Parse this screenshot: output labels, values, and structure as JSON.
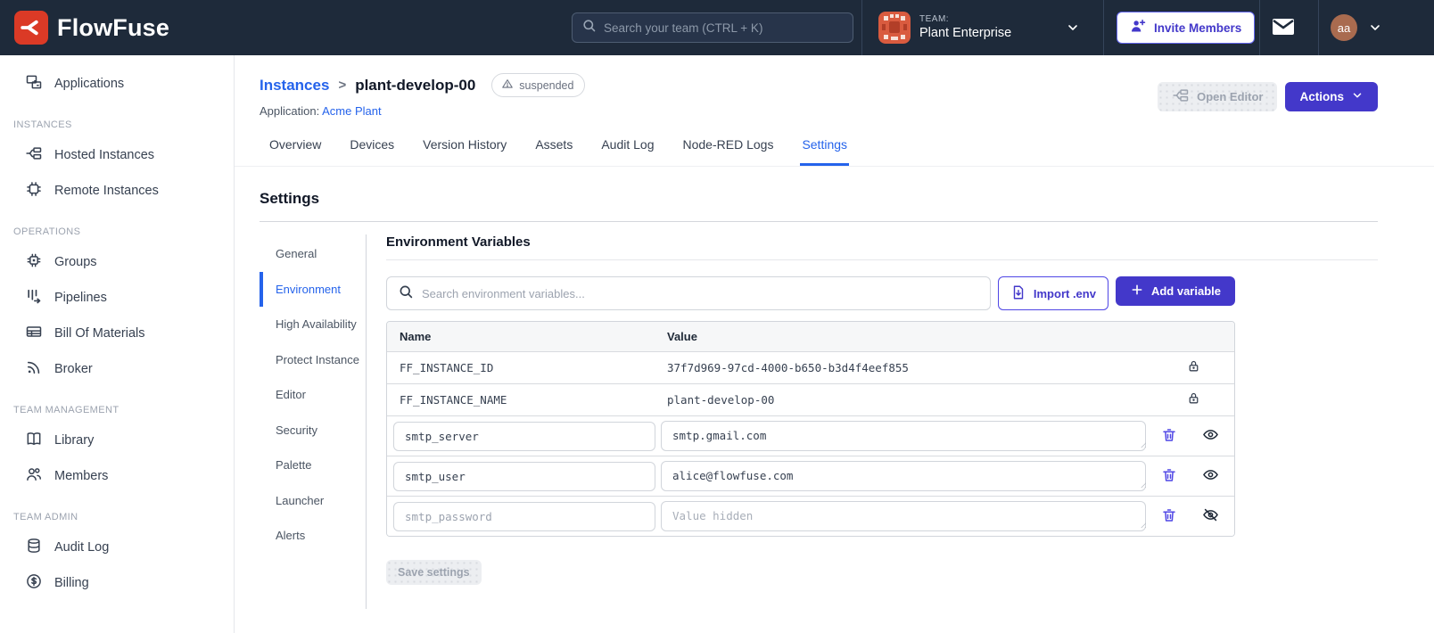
{
  "colors": {
    "header_bg": "#1E2A3A",
    "brand_red": "#DB3A26",
    "accent_indigo": "#4338CA",
    "link_blue": "#2563EB",
    "muted_gray": "#9CA3AF"
  },
  "header": {
    "brand": "FlowFuse",
    "search_placeholder": "Search your team (CTRL + K)",
    "team_label": "TEAM:",
    "team_name": "Plant Enterprise",
    "invite_button": "Invite Members",
    "avatar_initials": "aa",
    "icons": [
      "search-icon",
      "chevron-down-icon",
      "user-plus-icon",
      "mail-icon"
    ]
  },
  "sidebar": {
    "sections": [
      {
        "title": "",
        "items": [
          {
            "label": "Applications",
            "icon": "applications-icon"
          }
        ]
      },
      {
        "title": "INSTANCES",
        "items": [
          {
            "label": "Hosted Instances",
            "icon": "hosted-instances-icon"
          },
          {
            "label": "Remote Instances",
            "icon": "remote-instances-icon"
          }
        ]
      },
      {
        "title": "OPERATIONS",
        "items": [
          {
            "label": "Groups",
            "icon": "groups-icon"
          },
          {
            "label": "Pipelines",
            "icon": "pipelines-icon"
          },
          {
            "label": "Bill Of Materials",
            "icon": "bill-of-materials-icon"
          },
          {
            "label": "Broker",
            "icon": "broker-icon"
          }
        ]
      },
      {
        "title": "TEAM MANAGEMENT",
        "items": [
          {
            "label": "Library",
            "icon": "library-icon"
          },
          {
            "label": "Members",
            "icon": "members-icon"
          }
        ]
      },
      {
        "title": "TEAM ADMIN",
        "items": [
          {
            "label": "Audit Log",
            "icon": "audit-log-icon"
          },
          {
            "label": "Billing",
            "icon": "billing-icon"
          }
        ]
      }
    ]
  },
  "page": {
    "breadcrumb_parent": "Instances",
    "breadcrumb_separator": ">",
    "breadcrumb_current": "plant-develop-00",
    "status_badge": "suspended",
    "application_label": "Application:",
    "application_name": "Acme Plant",
    "open_editor_button": "Open Editor",
    "actions_button": "Actions"
  },
  "tabs": {
    "active": "Settings",
    "items": [
      {
        "label": "Overview"
      },
      {
        "label": "Devices"
      },
      {
        "label": "Version History"
      },
      {
        "label": "Assets"
      },
      {
        "label": "Audit Log"
      },
      {
        "label": "Node-RED Logs"
      },
      {
        "label": "Settings"
      }
    ]
  },
  "settings": {
    "title": "Settings",
    "active_nav": "Environment",
    "nav": [
      {
        "label": "General"
      },
      {
        "label": "Environment"
      },
      {
        "label": "High Availability"
      },
      {
        "label": "Protect Instance"
      },
      {
        "label": "Editor"
      },
      {
        "label": "Security"
      },
      {
        "label": "Palette"
      },
      {
        "label": "Launcher"
      },
      {
        "label": "Alerts"
      }
    ]
  },
  "env": {
    "heading": "Environment Variables",
    "search_placeholder": "Search environment variables...",
    "import_button": "Import .env",
    "add_button": "Add variable",
    "columns": {
      "name": "Name",
      "value": "Value"
    },
    "rows": [
      {
        "name": "FF_INSTANCE_ID",
        "value": "37f7d969-97cd-4000-b650-b3d4f4eef855",
        "locked": true
      },
      {
        "name": "FF_INSTANCE_NAME",
        "value": "plant-develop-00",
        "locked": true
      },
      {
        "name": "smtp_server",
        "value": "smtp.gmail.com",
        "locked": false,
        "visible": true
      },
      {
        "name": "smtp_user",
        "value": "alice@flowfuse.com",
        "locked": false,
        "visible": true
      },
      {
        "name": "smtp_password",
        "value": "",
        "value_placeholder": "Value hidden",
        "locked": false,
        "visible": false
      }
    ],
    "save_button": "Save settings"
  }
}
